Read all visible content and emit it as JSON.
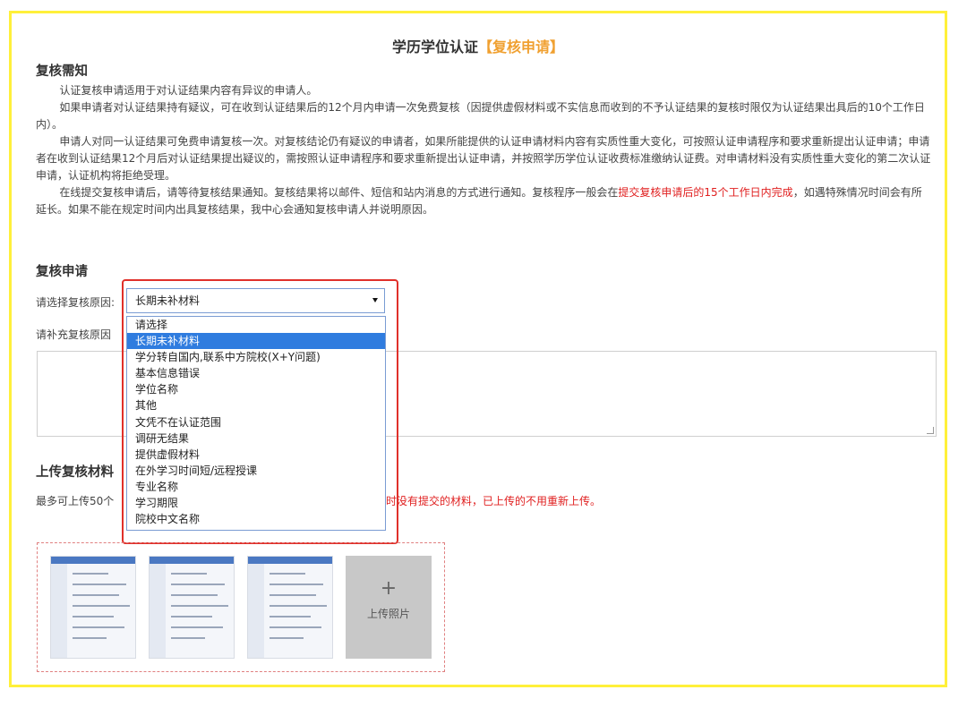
{
  "title": {
    "main": "学历学位认证",
    "accent": "【复核申请】"
  },
  "notice": {
    "heading": "复核需知",
    "p1": "认证复核申请适用于对认证结果内容有异议的申请人。",
    "p2": "如果申请者对认证结果持有疑议，可在收到认证结果后的12个月内申请一次免费复核（因提供虚假材料或不实信息而收到的不予认证结果的复核时限仅为认证结果出具后的10个工作日内）。",
    "p3": "申请人对同一认证结果可免费申请复核一次。对复核结论仍有疑议的申请者，如果所能提供的认证申请材料内容有实质性重大变化，可按照认证申请程序和要求重新提出认证申请；申请者在收到认证结果12个月后对认证结果提出疑议的，需按照认证申请程序和要求重新提出认证申请，并按照学历学位认证收费标准缴纳认证费。对申请材料没有实质性重大变化的第二次认证申请，认证机构将拒绝受理。",
    "p4_before": "在线提交复核申请后，请等待复核结果通知。复核结果将以邮件、短信和站内消息的方式进行通知。复核程序一般会在",
    "p4_highlight": "提交复核申请后的15个工作日内完成",
    "p4_after": "，如遇特殊情况时间会有所延长。如果不能在规定时间内出具复核结果，我中心会通知复核申请人并说明原因。"
  },
  "form": {
    "heading": "复核申请",
    "reason_label": "请选择复核原因:",
    "reason_selected": "长期未补材料",
    "reason_options": [
      "请选择",
      "长期未补材料",
      "学分转自国内,联系中方院校(X+Y问题)",
      "基本信息错误",
      "学位名称",
      "其他",
      "文凭不在认证范围",
      "调研无结果",
      "提供虚假材料",
      "在外学习时间短/远程授课",
      "专业名称",
      "学习期限",
      "院校中文名称"
    ],
    "selected_index": 1,
    "supplement_label": "请补充复核原因"
  },
  "upload": {
    "heading": "上传复核材料",
    "note_prefix": "最多可上传50个",
    "note_highlight": "时没有提交的材料，已上传的不用重新上传。",
    "add_label": "上传照片",
    "add_icon": "plus-icon",
    "thumbnails": [
      "screenshot-1",
      "screenshot-2",
      "screenshot-3"
    ]
  },
  "colors": {
    "frame": "#fff03a",
    "accent": "#f0a030",
    "highlight": "#e02020",
    "selected_option": "#2f7cdf",
    "callout": "#e0302a"
  }
}
